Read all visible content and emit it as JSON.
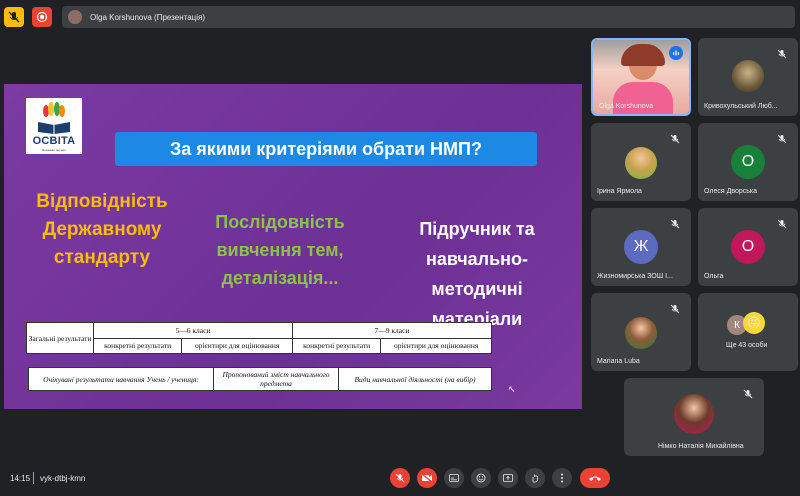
{
  "presenter_bar": {
    "text": "Olga Korshunova (Презентація)"
  },
  "slide": {
    "logo_text": "ОСВІТА",
    "logo_subtext": "Вишневе дерево",
    "title": "За якими критеріями обрати НМП?",
    "col1_lines": [
      "Відповідність",
      "Державному",
      "стандарту"
    ],
    "col2_lines": [
      "Послідовність",
      "вивчення тем,",
      "деталізація..."
    ],
    "col3_lines": [
      "Підручник та",
      "навчально-",
      "методичні",
      "матеріали"
    ],
    "table1": {
      "row_header": "Загальні результати",
      "group1": "5—6 класи",
      "group2": "7—9 класи",
      "sub": [
        "конкретні результати",
        "орієнтири для оцінювання",
        "конкретні результати",
        "орієнтири для оцінювання"
      ]
    },
    "table2": {
      "cols": [
        "Очікувані результати навчання Учень / учениця:",
        "Пропонований зміст навчального предмета",
        "Види навчальної діяльності (на вибір)"
      ]
    }
  },
  "participants": [
    {
      "name": "Olga Korshunova",
      "kind": "video",
      "mic": "speaking"
    },
    {
      "name": "Кривохульський Люб...",
      "kind": "photo",
      "mic": "muted"
    },
    {
      "name": "Ірина Ярмола",
      "kind": "photo",
      "mic": "muted"
    },
    {
      "name": "Олеся Дворська",
      "kind": "letter",
      "letter": "О",
      "color": "#188038",
      "mic": "muted"
    },
    {
      "name": "Жизномирська ЗОШ І...",
      "kind": "letter",
      "letter": "Ж",
      "color": "#5c6bc0",
      "mic": "muted"
    },
    {
      "name": "Ольга",
      "kind": "letter",
      "letter": "О",
      "color": "#c2185b",
      "mic": "muted"
    },
    {
      "name": "Mariana Luba",
      "kind": "photo",
      "mic": "muted"
    },
    {
      "name": "Ще 43 особи",
      "kind": "others",
      "letter": "К",
      "mic": "none"
    },
    {
      "name": "Німко Наталія Михайлівна",
      "kind": "photo",
      "mic": "muted"
    }
  ],
  "bottom": {
    "time": "14:15",
    "meeting_code": "vyk-dtbj-kmn"
  },
  "colors": {
    "accent_red": "#ea4335",
    "warning_yellow": "#fbbc04",
    "tile_bg": "#3c4043",
    "slide_purple": "#7c3aa3"
  }
}
